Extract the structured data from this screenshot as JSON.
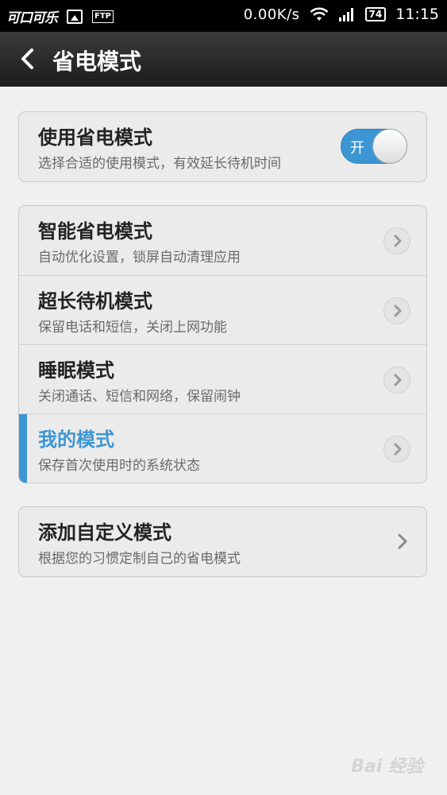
{
  "status_bar": {
    "carrier": "可口可乐",
    "ftp": "FTP",
    "speed": "0.00K/s",
    "battery": "74",
    "time": "11:15"
  },
  "header": {
    "title": "省电模式"
  },
  "power_saving": {
    "title": "使用省电模式",
    "subtitle": "选择合适的使用模式，有效延长待机时间",
    "toggle_label": "开",
    "enabled": true
  },
  "modes": [
    {
      "title": "智能省电模式",
      "subtitle": "自动优化设置，锁屏自动清理应用",
      "selected": false
    },
    {
      "title": "超长待机模式",
      "subtitle": "保留电话和短信，关闭上网功能",
      "selected": false
    },
    {
      "title": "睡眠模式",
      "subtitle": "关闭通话、短信和网络，保留闹钟",
      "selected": false
    },
    {
      "title": "我的模式",
      "subtitle": "保存首次使用时的系统状态",
      "selected": true
    }
  ],
  "custom": {
    "title": "添加自定义模式",
    "subtitle": "根据您的习惯定制自己的省电模式"
  },
  "watermark": "Bai 经验",
  "colors": {
    "accent": "#3c96d4",
    "title_bar": "#262626",
    "background": "#f0f0f0"
  }
}
